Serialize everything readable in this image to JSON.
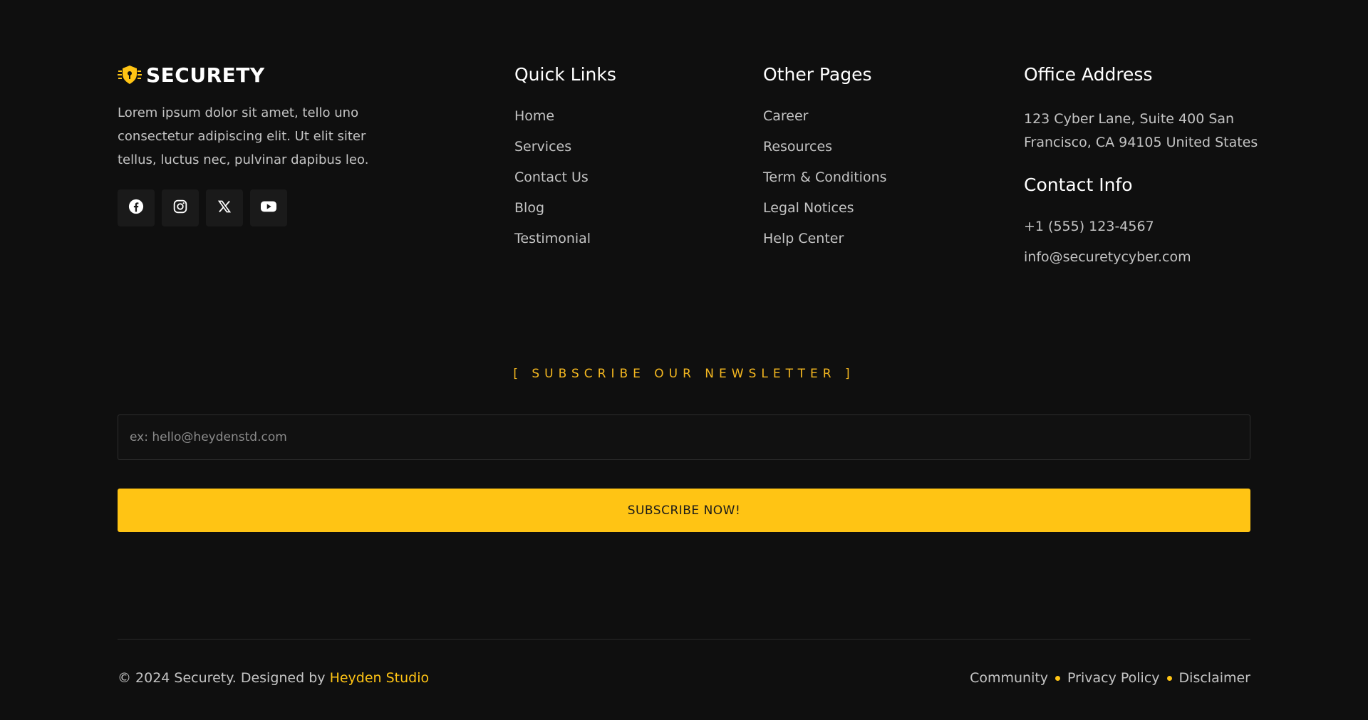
{
  "brand": {
    "name": "SECURETY",
    "description": "Lorem ipsum dolor sit amet, tello uno consectetur adipiscing elit. Ut elit siter tellus, luctus nec, pulvinar dapibus leo.",
    "accent_color": "#ffc414",
    "socials": [
      {
        "icon": "facebook-icon"
      },
      {
        "icon": "instagram-icon"
      },
      {
        "icon": "x-twitter-icon"
      },
      {
        "icon": "youtube-icon"
      }
    ]
  },
  "quick_links": {
    "title": "Quick Links",
    "items": [
      "Home",
      "Services",
      "Contact Us",
      "Blog",
      "Testimonial"
    ]
  },
  "other_pages": {
    "title": "Other Pages",
    "items": [
      "Career",
      "Resources",
      "Term & Conditions",
      "Legal Notices",
      "Help Center"
    ]
  },
  "office": {
    "title": "Office Address",
    "address": "123 Cyber Lane, Suite 400 San Francisco, CA 94105 United States",
    "contact_title": "Contact Info",
    "phone": "+1 (555) 123-4567",
    "email": "info@securetycyber.com"
  },
  "newsletter": {
    "label": "[ SUBSCRIBE OUR NEWSLETTER ]",
    "placeholder": "ex: hello@heydenstd.com",
    "button_label": "SUBSCRIBE NOW!"
  },
  "bottom_bar": {
    "copyright_prefix": "© 2024 Securety. Designed by ",
    "studio": "Heyden Studio",
    "links": [
      "Community",
      "Privacy Policy",
      "Disclaimer"
    ]
  }
}
